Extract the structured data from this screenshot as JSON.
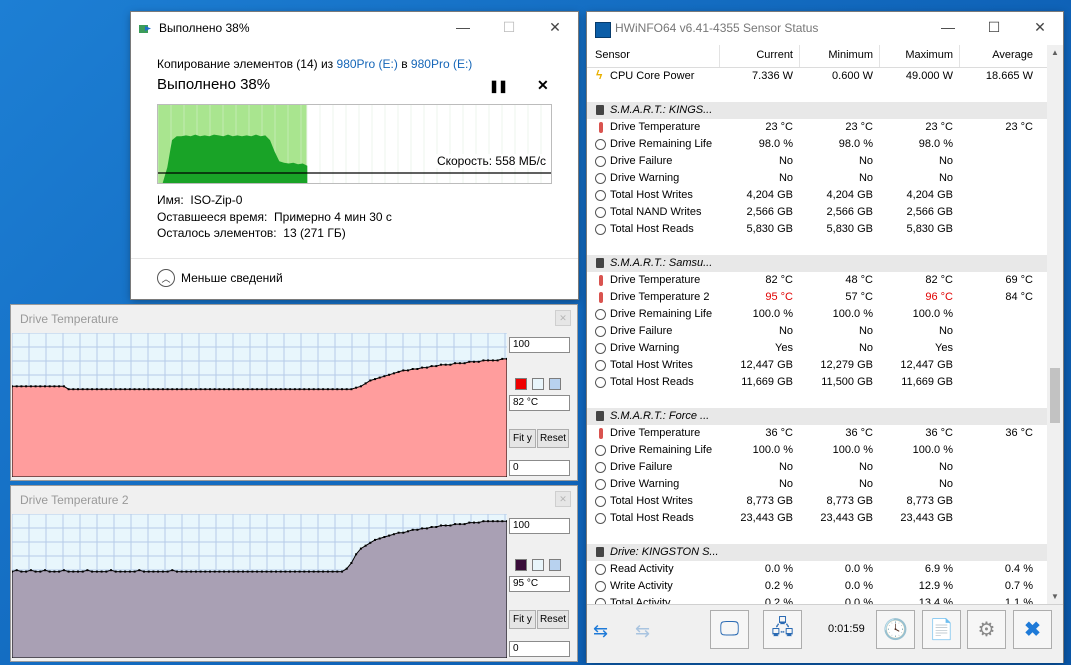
{
  "copy_dialog": {
    "title": "Выполнено 38%",
    "copy_prefix": "Копирование элементов (14) из ",
    "source": "980Pro (E:)",
    "copy_mid": " в ",
    "dest": "980Pro (E:)",
    "progress_title": "Выполнено 38%",
    "progress": 0.38,
    "speed": "Скорость: 558 МБ/с",
    "name_label": "Имя:",
    "name_value": "ISO-Zip-0",
    "time_label": "Оставшееся время:",
    "time_value": "Примерно 4 мин 30 с",
    "items_label": "Осталось элементов:",
    "items_value": "13 (271 ГБ)",
    "less_details": "Меньше сведений"
  },
  "graphs": [
    {
      "title": "Drive Temperature",
      "max": "100",
      "current": "82 °C",
      "min": "0",
      "fit_label": "Fit y",
      "reset_label": "Reset",
      "color": "#ff9d9d",
      "swatch_color": "#ee0000",
      "values": [
        63,
        63,
        63,
        63,
        63,
        63,
        63,
        63,
        63,
        63,
        63,
        63,
        61,
        61,
        61,
        61,
        61,
        61,
        61,
        61,
        61,
        61,
        61,
        61,
        61,
        61,
        61,
        61,
        61,
        61,
        61,
        61,
        61,
        61,
        61,
        61,
        61,
        61,
        61,
        61,
        61,
        61,
        61,
        61,
        61,
        61,
        61,
        61,
        61,
        61,
        61,
        61,
        61,
        61,
        61,
        61,
        61,
        61,
        61,
        61,
        61,
        61,
        61,
        61,
        61,
        61,
        61,
        61,
        61,
        61,
        61,
        61,
        61,
        62,
        63,
        65,
        67,
        68,
        69,
        70,
        71,
        72,
        73,
        74,
        74,
        75,
        75,
        76,
        76,
        77,
        77,
        78,
        78,
        78,
        79,
        79,
        79,
        80,
        80,
        80,
        81,
        81,
        81,
        81,
        82,
        82
      ]
    },
    {
      "title": "Drive Temperature 2",
      "max": "100",
      "current": "95 °C",
      "min": "0",
      "fit_label": "Fit y",
      "reset_label": "Reset",
      "color": "#a9a0b4",
      "swatch_color": "#3a0d3a",
      "values": [
        60,
        61,
        60,
        60,
        61,
        60,
        60,
        61,
        60,
        60,
        60,
        61,
        60,
        60,
        60,
        60,
        61,
        60,
        60,
        60,
        60,
        61,
        60,
        60,
        60,
        60,
        60,
        61,
        60,
        60,
        60,
        60,
        60,
        60,
        61,
        60,
        60,
        60,
        60,
        60,
        60,
        60,
        60,
        60,
        60,
        60,
        60,
        60,
        60,
        60,
        60,
        60,
        60,
        60,
        60,
        60,
        60,
        60,
        60,
        60,
        60,
        60,
        60,
        60,
        60,
        60,
        60,
        60,
        60,
        60,
        60,
        62,
        66,
        72,
        76,
        78,
        80,
        82,
        83,
        84,
        85,
        86,
        87,
        87,
        88,
        89,
        89,
        90,
        90,
        91,
        91,
        92,
        92,
        92,
        93,
        93,
        93,
        94,
        94,
        94,
        95,
        95,
        95,
        95,
        95,
        95
      ]
    }
  ],
  "hwinfo": {
    "title": "HWiNFO64 v6.41-4355 Sensor Status",
    "headers": [
      "Sensor",
      "Current",
      "Minimum",
      "Maximum",
      "Average"
    ],
    "rows": [
      {
        "icon": "bolt",
        "name": "CPU Core Power",
        "cur": "7.336 W",
        "min": "0.600 W",
        "max": "49.000 W",
        "avg": "18.665 W"
      },
      {
        "icon": "blank",
        "name": "",
        "cur": "",
        "min": "",
        "max": "",
        "avg": ""
      },
      {
        "icon": "drive",
        "group": true,
        "name": "S.M.A.R.T.: KINGS...",
        "cur": "",
        "min": "",
        "max": "",
        "avg": ""
      },
      {
        "icon": "thermo",
        "name": "Drive Temperature",
        "cur": "23 °C",
        "min": "23 °C",
        "max": "23 °C",
        "avg": "23 °C"
      },
      {
        "icon": "clock",
        "name": "Drive Remaining Life",
        "cur": "98.0 %",
        "min": "98.0 %",
        "max": "98.0 %",
        "avg": ""
      },
      {
        "icon": "clock",
        "name": "Drive Failure",
        "cur": "No",
        "min": "No",
        "max": "No",
        "avg": ""
      },
      {
        "icon": "clock",
        "name": "Drive Warning",
        "cur": "No",
        "min": "No",
        "max": "No",
        "avg": ""
      },
      {
        "icon": "clock",
        "name": "Total Host Writes",
        "cur": "4,204 GB",
        "min": "4,204 GB",
        "max": "4,204 GB",
        "avg": ""
      },
      {
        "icon": "clock",
        "name": "Total NAND Writes",
        "cur": "2,566 GB",
        "min": "2,566 GB",
        "max": "2,566 GB",
        "avg": ""
      },
      {
        "icon": "clock",
        "name": "Total Host Reads",
        "cur": "5,830 GB",
        "min": "5,830 GB",
        "max": "5,830 GB",
        "avg": ""
      },
      {
        "icon": "blank",
        "name": "",
        "cur": "",
        "min": "",
        "max": "",
        "avg": ""
      },
      {
        "icon": "drive",
        "group": true,
        "name": "S.M.A.R.T.: Samsu...",
        "cur": "",
        "min": "",
        "max": "",
        "avg": ""
      },
      {
        "icon": "thermo",
        "name": "Drive Temperature",
        "cur": "82 °C",
        "min": "48 °C",
        "max": "82 °C",
        "avg": "69 °C"
      },
      {
        "icon": "thermo",
        "name": "Drive Temperature 2",
        "cur": "95 °C",
        "min": "57 °C",
        "max": "96 °C",
        "avg": "84 °C",
        "cur_red": true,
        "max_red": true
      },
      {
        "icon": "clock",
        "name": "Drive Remaining Life",
        "cur": "100.0 %",
        "min": "100.0 %",
        "max": "100.0 %",
        "avg": ""
      },
      {
        "icon": "clock",
        "name": "Drive Failure",
        "cur": "No",
        "min": "No",
        "max": "No",
        "avg": ""
      },
      {
        "icon": "clock",
        "name": "Drive Warning",
        "cur": "Yes",
        "min": "No",
        "max": "Yes",
        "avg": ""
      },
      {
        "icon": "clock",
        "name": "Total Host Writes",
        "cur": "12,447 GB",
        "min": "12,279 GB",
        "max": "12,447 GB",
        "avg": ""
      },
      {
        "icon": "clock",
        "name": "Total Host Reads",
        "cur": "11,669 GB",
        "min": "11,500 GB",
        "max": "11,669 GB",
        "avg": ""
      },
      {
        "icon": "blank",
        "name": "",
        "cur": "",
        "min": "",
        "max": "",
        "avg": ""
      },
      {
        "icon": "drive",
        "group": true,
        "name": "S.M.A.R.T.: Force ...",
        "cur": "",
        "min": "",
        "max": "",
        "avg": ""
      },
      {
        "icon": "thermo",
        "name": "Drive Temperature",
        "cur": "36 °C",
        "min": "36 °C",
        "max": "36 °C",
        "avg": "36 °C"
      },
      {
        "icon": "clock",
        "name": "Drive Remaining Life",
        "cur": "100.0 %",
        "min": "100.0 %",
        "max": "100.0 %",
        "avg": ""
      },
      {
        "icon": "clock",
        "name": "Drive Failure",
        "cur": "No",
        "min": "No",
        "max": "No",
        "avg": ""
      },
      {
        "icon": "clock",
        "name": "Drive Warning",
        "cur": "No",
        "min": "No",
        "max": "No",
        "avg": ""
      },
      {
        "icon": "clock",
        "name": "Total Host Writes",
        "cur": "8,773 GB",
        "min": "8,773 GB",
        "max": "8,773 GB",
        "avg": ""
      },
      {
        "icon": "clock",
        "name": "Total Host Reads",
        "cur": "23,443 GB",
        "min": "23,443 GB",
        "max": "23,443 GB",
        "avg": ""
      },
      {
        "icon": "blank",
        "name": "",
        "cur": "",
        "min": "",
        "max": "",
        "avg": ""
      },
      {
        "icon": "drive",
        "group": true,
        "name": "Drive: KINGSTON S...",
        "cur": "",
        "min": "",
        "max": "",
        "avg": ""
      },
      {
        "icon": "clock",
        "name": "Read Activity",
        "cur": "0.0 %",
        "min": "0.0 %",
        "max": "6.9 %",
        "avg": "0.4 %"
      },
      {
        "icon": "clock",
        "name": "Write Activity",
        "cur": "0.2 %",
        "min": "0.0 %",
        "max": "12.9 %",
        "avg": "0.7 %"
      },
      {
        "icon": "clock",
        "name": "Total Activity",
        "cur": "0.2 %",
        "min": "0.0 %",
        "max": "13.4 %",
        "avg": "1.1 %"
      }
    ],
    "timer": "0:01:59"
  }
}
